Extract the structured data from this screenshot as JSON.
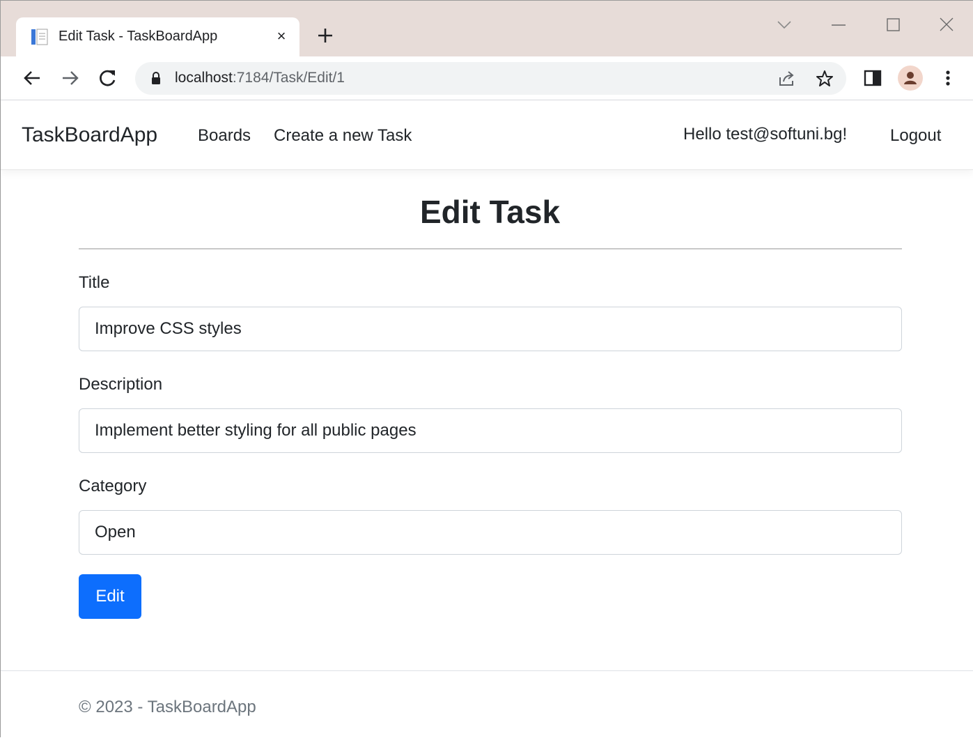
{
  "browser": {
    "tab_title": "Edit Task - TaskBoardApp",
    "tab_close": "×",
    "url_host": "localhost",
    "url_path": ":7184/Task/Edit/1",
    "icons": [
      "page-favicon",
      "close-icon",
      "plus-icon",
      "chevron-down-icon",
      "minimize-icon",
      "maximize-icon",
      "close-window-icon",
      "back-arrow-icon",
      "forward-arrow-icon",
      "reload-icon",
      "lock-icon",
      "share-icon",
      "star-icon",
      "side-panel-icon",
      "profile-avatar-icon",
      "more-vertical-icon"
    ]
  },
  "navbar": {
    "brand": "TaskBoardApp",
    "links": [
      "Boards",
      "Create a new Task"
    ],
    "greeting": "Hello test@softuni.bg!",
    "logout": "Logout"
  },
  "main": {
    "heading": "Edit Task",
    "fields": {
      "title_label": "Title",
      "title_value": "Improve CSS styles",
      "description_label": "Description",
      "description_value": "Implement better styling for all public pages",
      "category_label": "Category",
      "category_value": "Open"
    },
    "submit_label": "Edit"
  },
  "footer": {
    "text": "© 2023 - TaskBoardApp"
  },
  "colors": {
    "primary": "#0d6efd",
    "titlebar": "#e7dcd8",
    "omnibox": "#f1f3f4"
  }
}
